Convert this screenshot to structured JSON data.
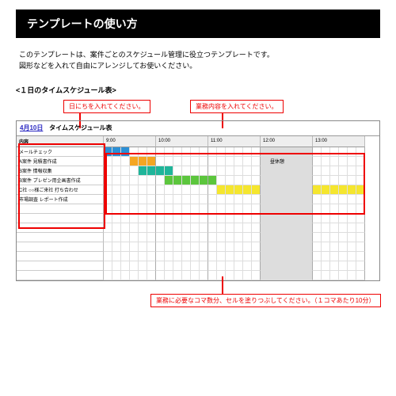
{
  "title": "テンプレートの使い方",
  "intro_line1": "このテンプレートは、案件ごとのスケジュール管理に役立つテンプレートです。",
  "intro_line2": "図形などを入れて自由にアレンジしてお使いください。",
  "subhead": "<１日のタイムスケジュール表>",
  "callout_date": "日にちを入れてください。",
  "callout_tasks": "業務内容を入れてください。",
  "callout_cells": "業務に必要なコマ数分、セルを塗りつぶしてください。（１コマあたり10分）",
  "sheet": {
    "date": "4月10日",
    "title": "タイムスケジュール表",
    "task_header": "内容",
    "times": [
      "9:00",
      "10:00",
      "11:00",
      "12:00",
      "13:00"
    ],
    "lunch_label": "昼休憩",
    "rows": [
      {
        "label": "メールチェック",
        "bars": [
          {
            "start": 0,
            "len": 3,
            "color": "c-blue"
          }
        ]
      },
      {
        "label": "A案件 見積書作成",
        "bars": [
          {
            "start": 3,
            "len": 3,
            "color": "c-orange"
          }
        ]
      },
      {
        "label": "B案件 情報収集",
        "bars": [
          {
            "start": 4,
            "len": 4,
            "color": "c-teal"
          }
        ]
      },
      {
        "label": "B案件 プレゼン用企画書作成",
        "bars": [
          {
            "start": 7,
            "len": 6,
            "color": "c-green"
          }
        ]
      },
      {
        "label": "C社 ○○様ご来社 打ち合わせ",
        "bars": [
          {
            "start": 13,
            "len": 5,
            "color": "c-yellow"
          },
          {
            "start": 24,
            "len": 6,
            "color": "c-yellow"
          }
        ]
      },
      {
        "label": "市場調査 レポート作成",
        "bars": []
      },
      {
        "label": "",
        "bars": []
      },
      {
        "label": "",
        "bars": []
      },
      {
        "label": "",
        "bars": []
      },
      {
        "label": "",
        "bars": []
      },
      {
        "label": "",
        "bars": []
      },
      {
        "label": "",
        "bars": []
      },
      {
        "label": "",
        "bars": []
      },
      {
        "label": "",
        "bars": []
      }
    ],
    "lunch_col_start": 18,
    "lunch_col_end": 24
  }
}
